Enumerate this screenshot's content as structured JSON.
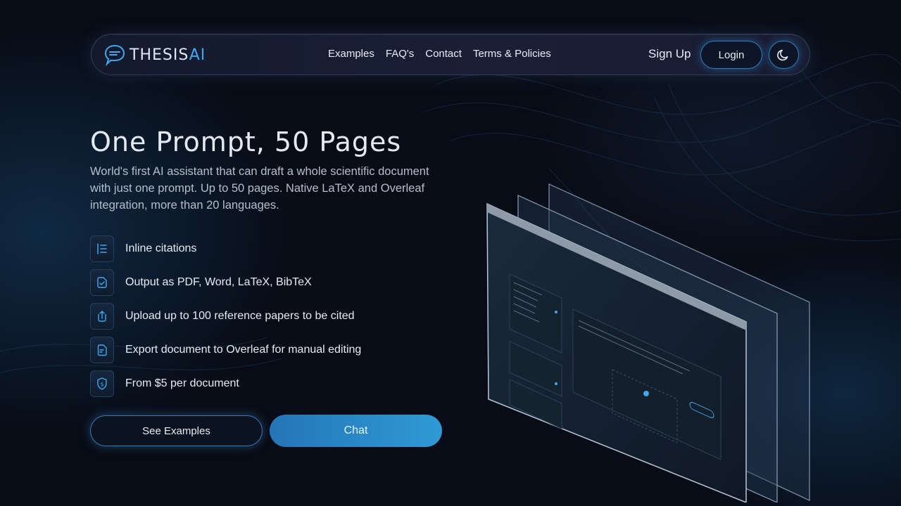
{
  "nav": {
    "logo_text": "THESIS",
    "logo_accent": "AI",
    "links": [
      "Examples",
      "FAQ's",
      "Contact",
      "Terms & Policies"
    ],
    "signup": "Sign Up",
    "login": "Login",
    "theme_icon": "moon-icon"
  },
  "hero": {
    "title": "One Prompt, 50 Pages",
    "subtitle": "World's first AI assistant that can draft a whole scientific document with just one prompt. Up to 50 pages. Native LaTeX and Overleaf integration, more than 20 languages."
  },
  "features": [
    {
      "icon": "list-icon",
      "label": "Inline citations"
    },
    {
      "icon": "file-check-icon",
      "label": "Output as PDF, Word, LaTeX, BibTeX"
    },
    {
      "icon": "upload-icon",
      "label": "Upload up to 100 reference papers to be cited"
    },
    {
      "icon": "document-edit-icon",
      "label": "Export document to Overleaf for manual editing"
    },
    {
      "icon": "dollar-shield-icon",
      "label": "From $5 per document"
    }
  ],
  "cta": {
    "examples": "See Examples",
    "chat": "Chat"
  },
  "colors": {
    "accent": "#2f9ad6",
    "background": "#080c16",
    "nav_border": "#2d7fc1"
  }
}
